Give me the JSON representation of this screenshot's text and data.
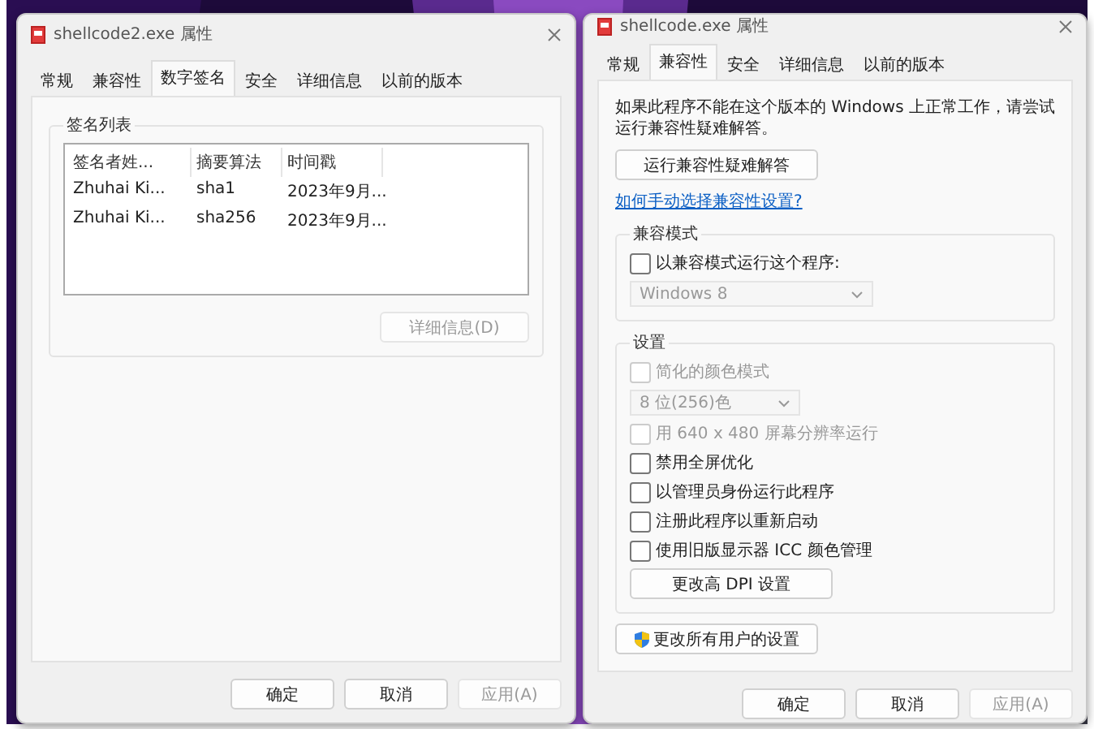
{
  "windows": [
    {
      "title": "shellcode2.exe 属性",
      "tabs": [
        {
          "label": "常规",
          "selected": false
        },
        {
          "label": "兼容性",
          "selected": false
        },
        {
          "label": "数字签名",
          "selected": true
        },
        {
          "label": "安全",
          "selected": false
        },
        {
          "label": "详细信息",
          "selected": false
        },
        {
          "label": "以前的版本",
          "selected": false
        }
      ],
      "signature_list": {
        "title": "签名列表",
        "columns": [
          "签名者姓...",
          "摘要算法",
          "时间戳"
        ],
        "rows": [
          [
            "Zhuhai Ki...",
            "sha1",
            "2023年9月..."
          ],
          [
            "Zhuhai Ki...",
            "sha256",
            "2023年9月..."
          ]
        ],
        "details_button": {
          "label": "详细信息(D)",
          "disabled": true
        }
      },
      "buttons": [
        {
          "label": "确定",
          "disabled": false
        },
        {
          "label": "取消",
          "disabled": false
        },
        {
          "label": "应用(A)",
          "disabled": true
        }
      ]
    },
    {
      "title": "shellcode.exe 属性",
      "tabs": [
        {
          "label": "常规",
          "selected": false
        },
        {
          "label": "兼容性",
          "selected": true
        },
        {
          "label": "安全",
          "selected": false
        },
        {
          "label": "详细信息",
          "selected": false
        },
        {
          "label": "以前的版本",
          "selected": false
        }
      ],
      "compatibility": {
        "description": "如果此程序不能在这个版本的 Windows 上正常工作，请尝试运行兼容性疑难解答。",
        "troubleshoot_button": "运行兼容性疑难解答",
        "link": "如何手动选择兼容性设置?",
        "compat_mode": {
          "title": "兼容模式",
          "checkbox": {
            "label": "以兼容模式运行这个程序:",
            "checked": false
          },
          "dropdown": {
            "value": "Windows 8",
            "disabled": true
          }
        },
        "settings": {
          "title": "设置",
          "items": [
            {
              "kind": "checkbox",
              "label": "简化的颜色模式",
              "checked": false,
              "disabled": true
            },
            {
              "kind": "dropdown",
              "label": "8 位(256)色",
              "disabled": true
            },
            {
              "kind": "checkbox",
              "label": "用 640 x 480 屏幕分辨率运行",
              "checked": false,
              "disabled": true
            },
            {
              "kind": "checkbox",
              "label": "禁用全屏优化",
              "checked": false,
              "disabled": false
            },
            {
              "kind": "checkbox",
              "label": "以管理员身份运行此程序",
              "checked": false,
              "disabled": false
            },
            {
              "kind": "checkbox",
              "label": "注册此程序以重新启动",
              "checked": false,
              "disabled": false
            },
            {
              "kind": "checkbox",
              "label": "使用旧版显示器 ICC 颜色管理",
              "checked": false,
              "disabled": false
            },
            {
              "kind": "button",
              "label": "更改高 DPI 设置",
              "disabled": false
            }
          ]
        },
        "all_users_button": "更改所有用户的设置"
      },
      "buttons": [
        {
          "label": "确定",
          "disabled": false
        },
        {
          "label": "取消",
          "disabled": false
        },
        {
          "label": "应用(A)",
          "disabled": true
        }
      ]
    }
  ]
}
